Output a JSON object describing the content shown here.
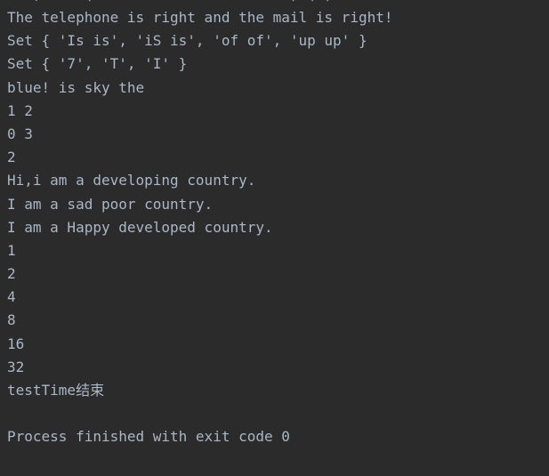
{
  "console": {
    "clipped_top_line": "..., ... ( ...... ..... ........ ).(.).",
    "lines": [
      "The telephone is right and the mail is right!",
      "Set { 'Is is', 'iS is', 'of of', 'up up' }",
      "Set { '7', 'T', 'I' }",
      "blue! is sky the",
      "1 2",
      "0 3",
      "2",
      "Hi,i am a developing country.",
      "I am a sad poor country.",
      "I am a Happy developed country.",
      "1",
      "2",
      "4",
      "8",
      "16",
      "32",
      "testTime结束",
      "",
      "Process finished with exit code 0"
    ]
  },
  "colors": {
    "background": "#2b2b2b",
    "text": "#a9b7c6"
  }
}
